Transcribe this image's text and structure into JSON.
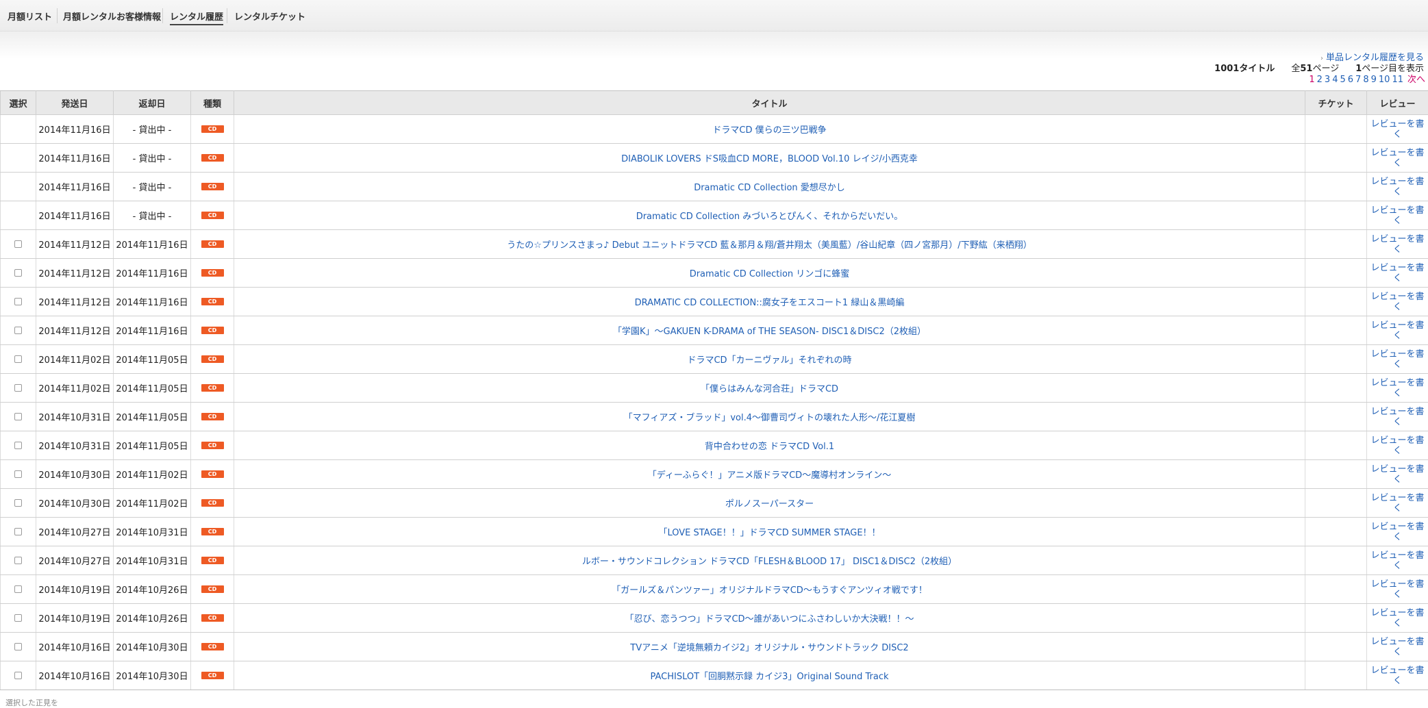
{
  "nav": {
    "tabs": [
      {
        "label": "月額リスト"
      },
      {
        "label": "月額レンタルお客様情報"
      },
      {
        "label": "レンタル履歴"
      },
      {
        "label": "レンタルチケット"
      }
    ]
  },
  "summary": {
    "history_link": "単品レンタル履歴を見る",
    "title_count": "1001タイトル",
    "pages_prefix": "全",
    "pages_total": "51",
    "pages_suffix": "ページ",
    "page_current": "1",
    "page_current_suffix": "ページ目を表示"
  },
  "pager": {
    "pages": [
      "1",
      "2",
      "3",
      "4",
      "5",
      "6",
      "7",
      "8",
      "9",
      "10",
      "11"
    ],
    "current": "1",
    "next_label": "次へ"
  },
  "table": {
    "headers": {
      "select": "選択",
      "ship_date": "発送日",
      "return_date": "返却日",
      "type": "種類",
      "title": "タイトル",
      "ticket": "チケット",
      "review": "レビュー"
    },
    "rows": [
      {
        "checkbox": false,
        "ship": "2014年11月16日",
        "ret": "- 貸出中 -",
        "type": "CD",
        "title": "ドラマCD 僕らの三ツ巴戦争",
        "ticket": "",
        "review": "レビューを書く"
      },
      {
        "checkbox": false,
        "ship": "2014年11月16日",
        "ret": "- 貸出中 -",
        "type": "CD",
        "title": "DIABOLIK LOVERS ドS吸血CD MORE，BLOOD Vol.10 レイジ/小西克幸",
        "ticket": "",
        "review": "レビューを書く"
      },
      {
        "checkbox": false,
        "ship": "2014年11月16日",
        "ret": "- 貸出中 -",
        "type": "CD",
        "title": "Dramatic CD Collection 愛想尽かし",
        "ticket": "",
        "review": "レビューを書く"
      },
      {
        "checkbox": false,
        "ship": "2014年11月16日",
        "ret": "- 貸出中 -",
        "type": "CD",
        "title": "Dramatic CD Collection みづいろとぴんく、それからだいだい。",
        "ticket": "",
        "review": "レビューを書く"
      },
      {
        "checkbox": true,
        "ship": "2014年11月12日",
        "ret": "2014年11月16日",
        "type": "CD",
        "title": "うたの☆プリンスさまっ♪ Debut ユニットドラマCD 藍＆那月＆翔/蒼井翔太（美風藍）/谷山紀章（四ノ宮那月）/下野紘（来栖翔）",
        "ticket": "",
        "review": "レビューを書く"
      },
      {
        "checkbox": true,
        "ship": "2014年11月12日",
        "ret": "2014年11月16日",
        "type": "CD",
        "title": "Dramatic CD Collection リンゴに蜂蜜",
        "ticket": "",
        "review": "レビューを書く"
      },
      {
        "checkbox": true,
        "ship": "2014年11月12日",
        "ret": "2014年11月16日",
        "type": "CD",
        "title": "DRAMATIC CD COLLECTION::腐女子をエスコート1 緑山＆黒崎編",
        "ticket": "",
        "review": "レビューを書く"
      },
      {
        "checkbox": true,
        "ship": "2014年11月12日",
        "ret": "2014年11月16日",
        "type": "CD",
        "title": "「学園K」〜GAKUEN K-DRAMA of THE SEASON- DISC1＆DISC2（2枚組）",
        "ticket": "",
        "review": "レビューを書く"
      },
      {
        "checkbox": true,
        "ship": "2014年11月02日",
        "ret": "2014年11月05日",
        "type": "CD",
        "title": "ドラマCD「カーニヴァル」それぞれの時",
        "ticket": "",
        "review": "レビューを書く"
      },
      {
        "checkbox": true,
        "ship": "2014年11月02日",
        "ret": "2014年11月05日",
        "type": "CD",
        "title": "「僕らはみんな河合荘」ドラマCD",
        "ticket": "",
        "review": "レビューを書く"
      },
      {
        "checkbox": true,
        "ship": "2014年10月31日",
        "ret": "2014年11月05日",
        "type": "CD",
        "title": "「マフィアズ・ブラッド」vol.4〜御曹司ヴィトの壊れた人形〜/花江夏樹",
        "ticket": "",
        "review": "レビューを書く"
      },
      {
        "checkbox": true,
        "ship": "2014年10月31日",
        "ret": "2014年11月05日",
        "type": "CD",
        "title": "背中合わせの恋 ドラマCD Vol.1",
        "ticket": "",
        "review": "レビューを書く"
      },
      {
        "checkbox": true,
        "ship": "2014年10月30日",
        "ret": "2014年11月02日",
        "type": "CD",
        "title": "「ディーふらぐ！」アニメ版ドラマCD〜魔導村オンライン〜",
        "ticket": "",
        "review": "レビューを書く"
      },
      {
        "checkbox": true,
        "ship": "2014年10月30日",
        "ret": "2014年11月02日",
        "type": "CD",
        "title": "ポルノスーパースター",
        "ticket": "",
        "review": "レビューを書く"
      },
      {
        "checkbox": true,
        "ship": "2014年10月27日",
        "ret": "2014年10月31日",
        "type": "CD",
        "title": "「LOVE STAGE！！」ドラマCD SUMMER STAGE！！",
        "ticket": "",
        "review": "レビューを書く"
      },
      {
        "checkbox": true,
        "ship": "2014年10月27日",
        "ret": "2014年10月31日",
        "type": "CD",
        "title": "ルボー・サウンドコレクション ドラマCD「FLESH＆BLOOD 17」 DISC1＆DISC2（2枚組）",
        "ticket": "",
        "review": "レビューを書く"
      },
      {
        "checkbox": true,
        "ship": "2014年10月19日",
        "ret": "2014年10月26日",
        "type": "CD",
        "title": "「ガールズ＆パンツァー」オリジナルドラマCD〜もうすぐアンツィオ戦です！",
        "ticket": "",
        "review": "レビューを書く"
      },
      {
        "checkbox": true,
        "ship": "2014年10月19日",
        "ret": "2014年10月26日",
        "type": "CD",
        "title": "「忍び、恋うつつ」ドラマCD〜誰があいつにふさわしいか大決戦！！〜",
        "ticket": "",
        "review": "レビューを書く"
      },
      {
        "checkbox": true,
        "ship": "2014年10月16日",
        "ret": "2014年10月30日",
        "type": "CD",
        "title": "TVアニメ「逆境無頼カイジ2」オリジナル・サウンドトラック DISC2",
        "ticket": "",
        "review": "レビューを書く"
      },
      {
        "checkbox": true,
        "ship": "2014年10月16日",
        "ret": "2014年10月30日",
        "type": "CD",
        "title": "PACHISLOT「回胴黙示録 カイジ3」Original Sound Track",
        "ticket": "",
        "review": "レビューを書く"
      }
    ]
  },
  "footer": {
    "text": "選択した正見を"
  },
  "colors": {
    "link": "#1f5fb5",
    "badge": "#ee5a24",
    "pager_current": "#cc0066",
    "header_bg": "#e9e9e9"
  }
}
